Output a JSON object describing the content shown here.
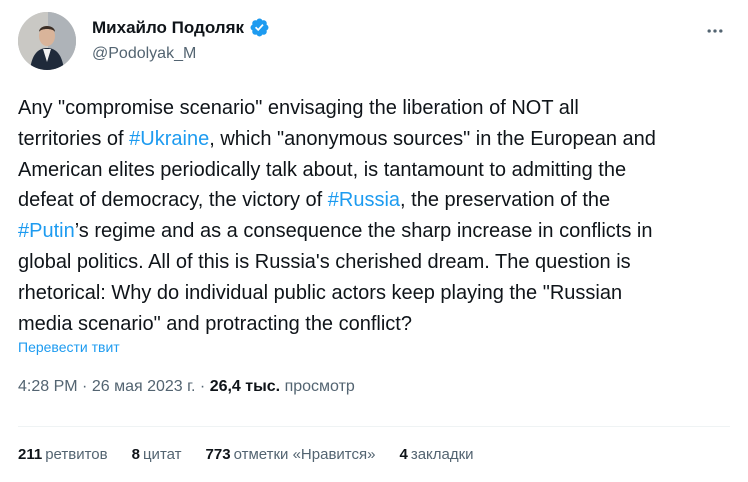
{
  "author": {
    "name": "Михайло Подоляк",
    "handle": "@Podolyak_M",
    "verified_color": "#1d9bf0"
  },
  "tweet": {
    "lines": [
      [
        {
          "t": "Any \"compromise scenario\" envisaging the liberation of NOT all"
        }
      ],
      [
        {
          "t": "territories of "
        },
        {
          "t": "#Ukraine",
          "tag": true
        },
        {
          "t": ", which \"anonymous sources\" in the European and"
        }
      ],
      [
        {
          "t": "American elites periodically talk about, is tantamount to admitting the"
        }
      ],
      [
        {
          "t": "defeat of democracy, the victory of "
        },
        {
          "t": "#Russia",
          "tag": true
        },
        {
          "t": ", the preservation of the"
        }
      ],
      [
        {
          "t": "#Putin",
          "tag": true
        },
        {
          "t": "’s regime and as a consequence the sharp increase in conflicts in"
        }
      ],
      [
        {
          "t": "global politics. All of this is Russia's cherished dream. The question is"
        }
      ],
      [
        {
          "t": "rhetorical: Why do individual public actors keep playing the \"Russian"
        }
      ],
      [
        {
          "t": "media scenario\" and protracting the conflict?"
        }
      ]
    ],
    "translate_label": "Перевести твит"
  },
  "meta": {
    "time": "4:28 PM",
    "separator": "·",
    "date": "26 мая 2023 г.",
    "views_count": "26,4 тыс.",
    "views_label": "просмотр"
  },
  "stats": [
    {
      "count": "211",
      "label": "ретвитов"
    },
    {
      "count": "8",
      "label": "цитат"
    },
    {
      "count": "773",
      "label": "отметки «Нравится»"
    },
    {
      "count": "4",
      "label": "закладки"
    }
  ],
  "colors": {
    "link": "#1d9bf0",
    "text": "#0f1419",
    "muted": "#536471",
    "divider": "#eff3f4"
  },
  "icons": {
    "avatar": "avatar",
    "verified": "verified-badge-icon",
    "more": "more-icon"
  }
}
